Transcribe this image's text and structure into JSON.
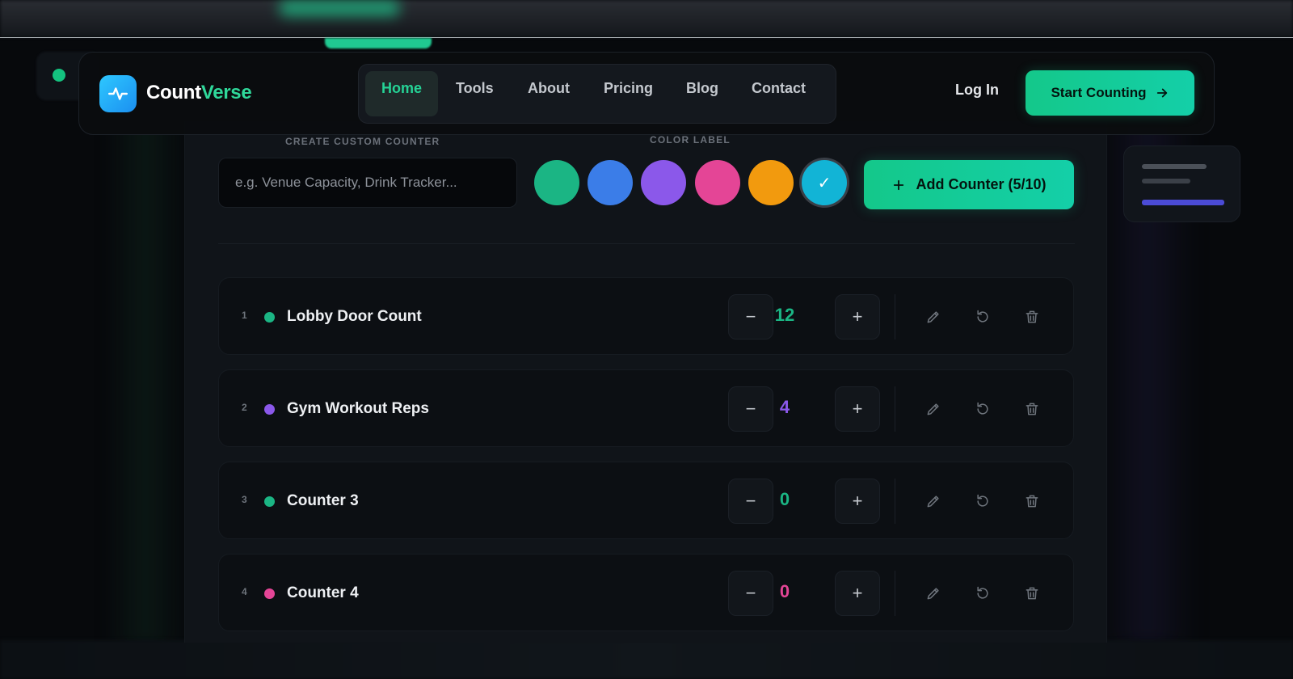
{
  "brand": {
    "name_part1": "Count",
    "name_part2": "Verse",
    "logo_icon": "pulse-icon"
  },
  "nav": {
    "items": [
      {
        "label": "Home",
        "active": true
      },
      {
        "label": "Tools",
        "active": false
      },
      {
        "label": "About",
        "active": false
      },
      {
        "label": "Pricing",
        "active": false
      },
      {
        "label": "Blog",
        "active": false
      },
      {
        "label": "Contact",
        "active": false
      }
    ],
    "login_label": "Log In",
    "cta_label": "Start Counting"
  },
  "create": {
    "input_label": "CREATE CUSTOM COUNTER",
    "placeholder": "e.g. Venue Capacity, Drink Tracker...",
    "color_label": "COLOR LABEL",
    "colors": [
      "#1bb584",
      "#3b7de8",
      "#8b58ea",
      "#e44596",
      "#f29a0e",
      "#12b4d6"
    ],
    "selected_color_index": 5,
    "check_mark": "✓",
    "add_label": "Add Counter (5/10)"
  },
  "counters": [
    {
      "index": "1",
      "name": "Lobby Door Count",
      "value": "12",
      "color": "#1bb584"
    },
    {
      "index": "2",
      "name": "Gym Workout Reps",
      "value": "4",
      "color": "#8b58ea"
    },
    {
      "index": "3",
      "name": "Counter 3",
      "value": "0",
      "color": "#1bb584"
    },
    {
      "index": "4",
      "name": "Counter 4",
      "value": "0",
      "color": "#e44596"
    }
  ],
  "controls": {
    "minus": "−",
    "plus": "+"
  }
}
